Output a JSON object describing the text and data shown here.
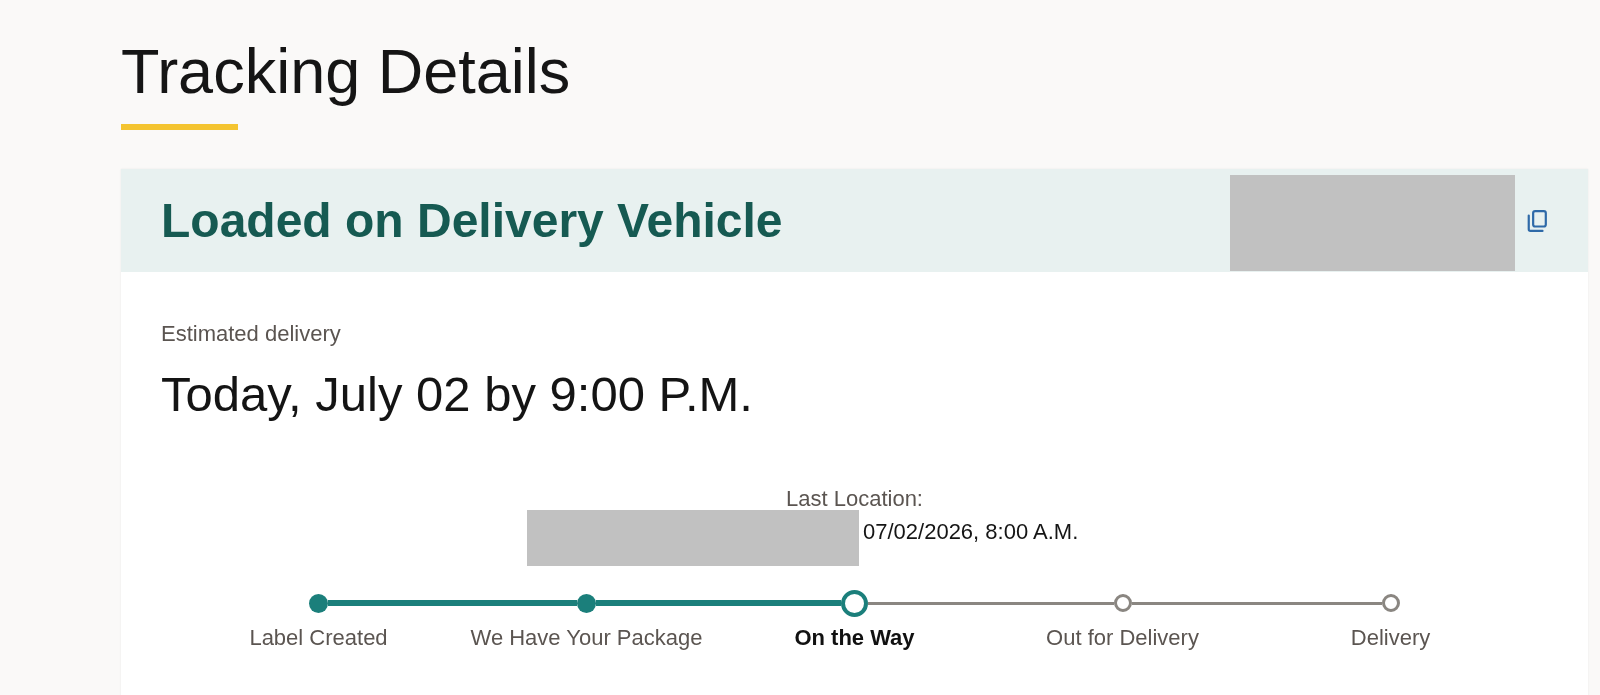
{
  "page_title": "Tracking Details",
  "shipment": {
    "status": "Loaded on Delivery Vehicle",
    "tracking_number": {
      "redacted": true
    },
    "estimated_delivery": {
      "label": "Estimated delivery",
      "value": "Today, July 02 by 9:00 P.M."
    },
    "last_location": {
      "label": "Last Location:",
      "place_redacted": true,
      "timestamp": "07/02/2026, 8:00 A.M."
    },
    "progress_steps": [
      {
        "label": "Label Created",
        "completed": true,
        "current": false
      },
      {
        "label": "We Have Your Package",
        "completed": true,
        "current": false
      },
      {
        "label": "On the Way",
        "completed": false,
        "current": true
      },
      {
        "label": "Out for Delivery",
        "completed": false,
        "current": false
      },
      {
        "label": "Delivery",
        "completed": false,
        "current": false
      }
    ]
  }
}
